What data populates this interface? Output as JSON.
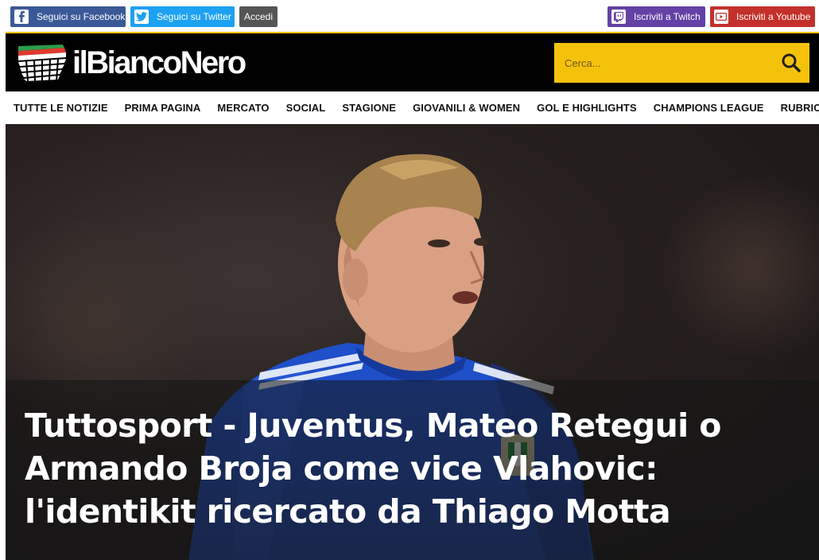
{
  "topbar": {
    "facebook_label": "Seguici su Facebook",
    "twitter_label": "Seguici su Twitter",
    "login_label": "Accedi",
    "twitch_label": "Iscriviti a Twitch",
    "youtube_label": "Iscriviti a Youtube"
  },
  "header": {
    "logo_text": "ilBiancoNero",
    "search_placeholder": "Cerca..."
  },
  "nav": {
    "items": [
      "TUTTE LE NOTIZIE",
      "PRIMA PAGINA",
      "MERCATO",
      "SOCIAL",
      "STAGIONE",
      "GIOVANILI & WOMEN",
      "GOL E HIGHLIGHTS",
      "CHAMPIONS LEAGUE",
      "RUBRICHE"
    ]
  },
  "hero": {
    "headline": "Tuttosport - Juventus, Mateo Retegui o Armando Broja come vice Vlahovic: l'identikit ricercato da Thiago Motta",
    "image": "footballer-italy-jersey-photo"
  },
  "colors": {
    "accent": "#f5c20b",
    "header_bg": "#000000",
    "facebook": "#3b5998",
    "twitter": "#1da1f2",
    "twitch": "#6441a5",
    "youtube": "#c4302b"
  },
  "icons": [
    "facebook-icon",
    "twitter-icon",
    "twitch-icon",
    "youtube-icon",
    "search-icon",
    "logo-stadium-icon"
  ]
}
